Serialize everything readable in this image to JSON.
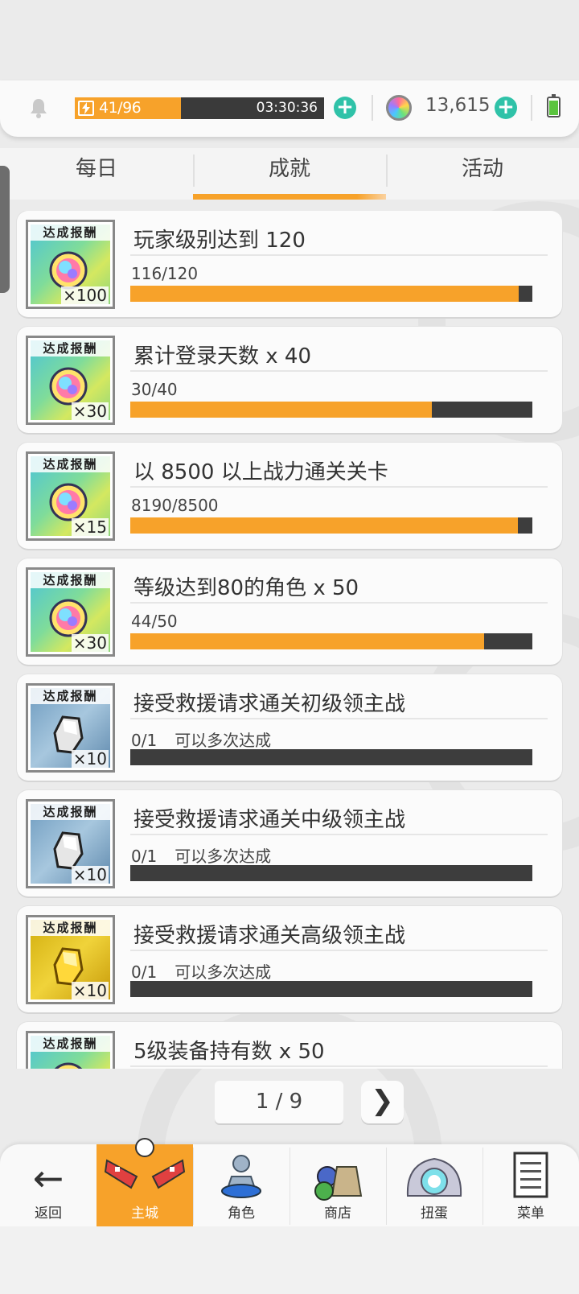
{
  "status": {
    "stamina_current": 41,
    "stamina_max": 96,
    "stamina_text": "41/96",
    "stamina_timer": "03:30:36",
    "gem_count": "13,615",
    "add_symbol": "+"
  },
  "tabs": [
    {
      "label": "每日",
      "active": false
    },
    {
      "label": "成就",
      "active": true
    },
    {
      "label": "活动",
      "active": false
    }
  ],
  "reward_label": "达成报酬",
  "achievements": [
    {
      "title": "玩家级别达到 120",
      "progress": "116/120",
      "note": "",
      "fill": 0.966,
      "reward": "gem",
      "qty": "×100"
    },
    {
      "title": "累计登录天数  x 40",
      "progress": "30/40",
      "note": "",
      "fill": 0.75,
      "reward": "gem",
      "qty": "×30"
    },
    {
      "title": "以 8500 以上战力通关关卡",
      "progress": "8190/8500",
      "note": "",
      "fill": 0.963,
      "reward": "gem",
      "qty": "×15"
    },
    {
      "title": "等级达到80的角色  x 50",
      "progress": "44/50",
      "note": "",
      "fill": 0.88,
      "reward": "gem",
      "qty": "×30"
    },
    {
      "title": "接受救援请求通关初级领主战",
      "progress": "0/1",
      "note": "可以多次达成",
      "fill": 0,
      "reward": "stone",
      "qty": "×10"
    },
    {
      "title": "接受救援请求通关中级领主战",
      "progress": "0/1",
      "note": "可以多次达成",
      "fill": 0,
      "reward": "stone",
      "qty": "×10"
    },
    {
      "title": "接受救援请求通关高级领主战",
      "progress": "0/1",
      "note": "可以多次达成",
      "fill": 0,
      "reward": "gold",
      "qty": "×10"
    },
    {
      "title": "5级装备持有数  x 50",
      "progress": "",
      "note": "",
      "fill": 0,
      "reward": "gem",
      "qty": ""
    }
  ],
  "pager": {
    "text": "1 / 9",
    "next_symbol": "❯"
  },
  "nav": [
    {
      "label": "返回",
      "icon": "back-arrow-icon",
      "active": false
    },
    {
      "label": "主城",
      "icon": "castle-icon",
      "active": true
    },
    {
      "label": "角色",
      "icon": "character-icon",
      "active": false
    },
    {
      "label": "商店",
      "icon": "shop-icon",
      "active": false
    },
    {
      "label": "扭蛋",
      "icon": "gacha-icon",
      "active": false
    },
    {
      "label": "菜单",
      "icon": "menu-icon",
      "active": false
    }
  ],
  "colors": {
    "accent": "#f7a22a",
    "bar_bg": "#3d3d3d",
    "plus": "#2fc2a8"
  }
}
